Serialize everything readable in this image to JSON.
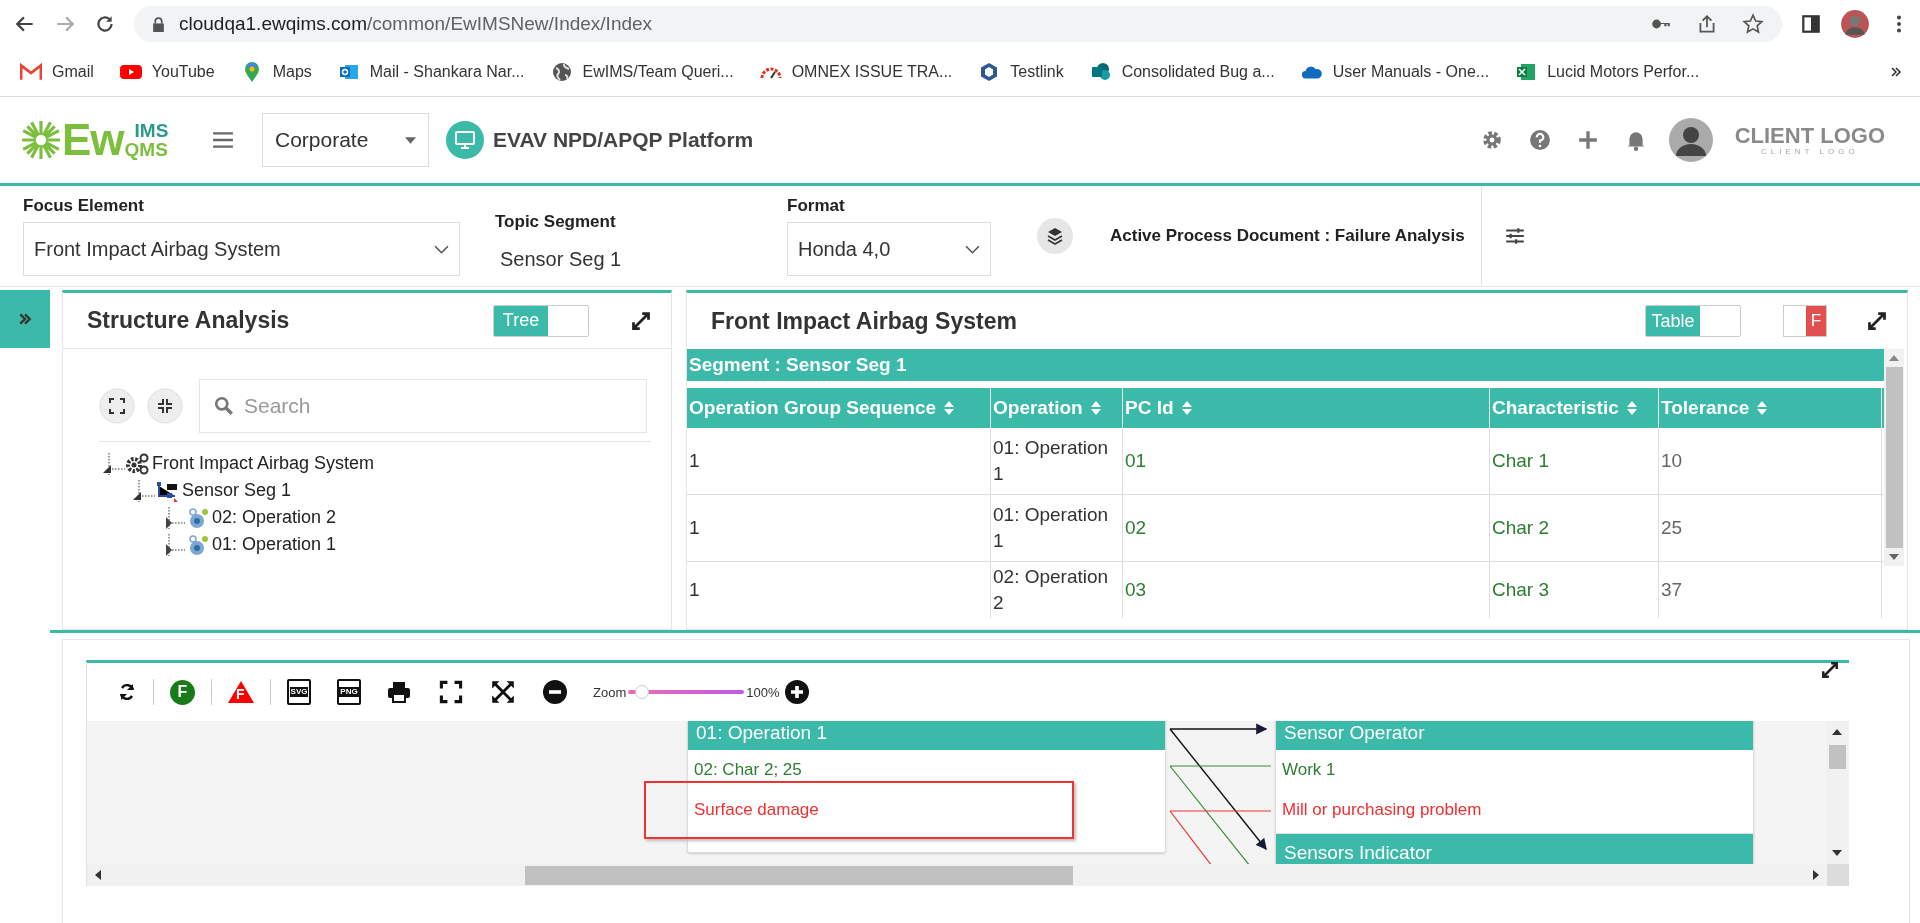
{
  "browser": {
    "url_host": "cloudqa1.ewqims.com",
    "url_path": "/common/EwIMSNew/Index/Index",
    "bookmarks": [
      {
        "label": "Gmail",
        "kind": "mail"
      },
      {
        "label": "YouTube",
        "kind": "video"
      },
      {
        "label": "Maps",
        "kind": "pin"
      },
      {
        "label": "Mail - Shankara Nar...",
        "kind": "outlook"
      },
      {
        "label": "EwIMS/Team Queri...",
        "kind": "globe"
      },
      {
        "label": "OMNEX ISSUE TRA...",
        "kind": "gauge"
      },
      {
        "label": "Testlink",
        "kind": "hexagon"
      },
      {
        "label": "Consolidated Bug a...",
        "kind": "share"
      },
      {
        "label": "User Manuals - One...",
        "kind": "cloud"
      },
      {
        "label": "Lucid Motors Perfor...",
        "kind": "sheet"
      }
    ]
  },
  "header": {
    "logo_main": "Ew",
    "logo_top": "IMS",
    "logo_bottom": "QMS",
    "workspace": "Corporate",
    "platform": "EVAV NPD/APQP Platform",
    "client_logo": "CLIENT LOGO",
    "client_logo_sub": "CLIENT LOGO"
  },
  "filters": {
    "focus_element": {
      "label": "Focus Element",
      "value": "Front Impact Airbag System"
    },
    "topic_segment": {
      "label": "Topic Segment",
      "value": "Sensor Seg 1"
    },
    "format": {
      "label": "Format",
      "value": "Honda 4,0"
    },
    "active_document": "Active Process Document : Failure Analysis"
  },
  "structure_panel": {
    "title": "Structure Analysis",
    "toggle": {
      "label": "Tree",
      "on": true
    },
    "search": {
      "placeholder": "Search"
    },
    "tree": [
      {
        "label": "Front Impact Airbag System",
        "kind": "system",
        "expanded": true,
        "children": [
          {
            "label": "Sensor Seg 1",
            "kind": "segment",
            "expanded": true,
            "children": [
              {
                "label": "02: Operation 2",
                "kind": "operation",
                "expanded": false
              },
              {
                "label": "01: Operation 1",
                "kind": "operation",
                "expanded": false
              }
            ]
          }
        ]
      }
    ]
  },
  "table_panel": {
    "title": "Front Impact Airbag System",
    "toggle": {
      "label": "Table",
      "on": true
    },
    "f_toggle": {
      "label": "F",
      "on": true
    },
    "segment": "Segment : Sensor Seg 1",
    "columns": [
      {
        "label": "Operation Group Sequence",
        "kind": "plain"
      },
      {
        "label": "Operation",
        "kind": "plain"
      },
      {
        "label": "PC Id",
        "kind": "link"
      },
      {
        "label": "Characteristic",
        "kind": "link"
      },
      {
        "label": "Tolerance",
        "kind": "muted"
      }
    ],
    "rows": [
      [
        "1",
        "01: Operation 1",
        "01",
        "Char 1",
        "10"
      ],
      [
        "1",
        "01: Operation 1",
        "02",
        "Char 2",
        "25"
      ],
      [
        "1",
        "02: Operation 2",
        "03",
        "Char 3",
        "37"
      ]
    ]
  },
  "diagram": {
    "toolbar": {
      "f_circle": "F",
      "f_triangle": "F",
      "svg": "SVG",
      "png": "PNG",
      "zoom_label": "Zoom",
      "zoom": {
        "level": 0.12
      },
      "zoom_reading": "100%"
    },
    "nodes": [
      {
        "heading": "01: Operation 1",
        "lines": [
          {
            "text": "02: Char 2; 25",
            "kind": "characteristic",
            "highlighted": false
          },
          {
            "text": "Surface damage",
            "kind": "failure",
            "highlighted": true
          }
        ]
      },
      {
        "heading": "Sensor Operator",
        "lines": [
          {
            "text": "Work 1",
            "kind": "characteristic",
            "highlighted": false
          },
          {
            "text": "Mill or purchasing problem",
            "kind": "failure",
            "highlighted": false
          }
        ]
      },
      {
        "heading": "Sensors Indicator"
      }
    ]
  }
}
